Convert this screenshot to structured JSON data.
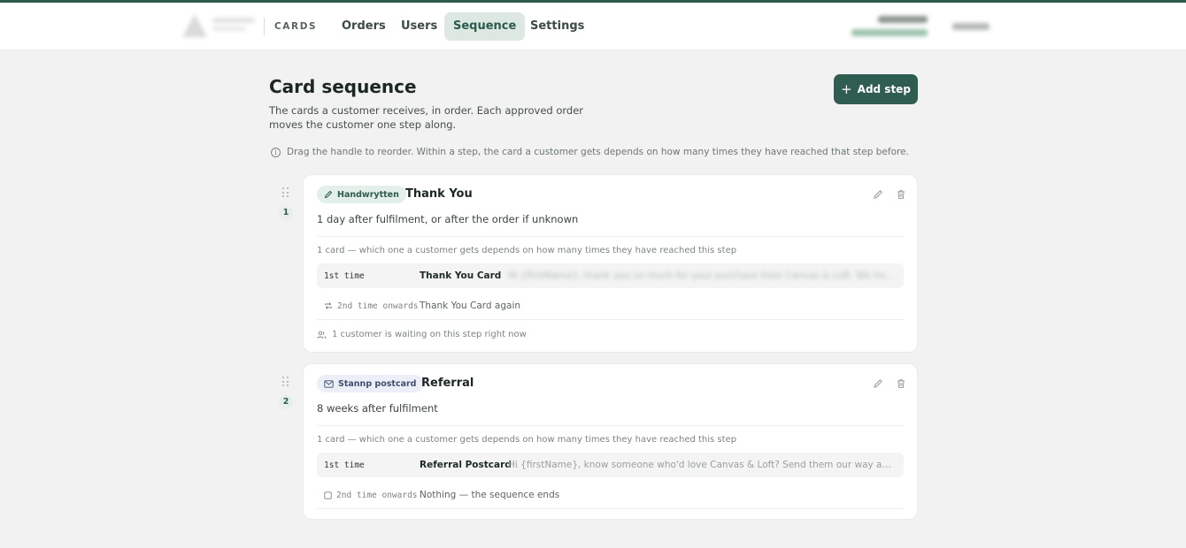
{
  "nav": {
    "brand": "CARDS",
    "items": [
      "Orders",
      "Users",
      "Sequence",
      "Settings"
    ],
    "active": "Sequence"
  },
  "page": {
    "title": "Card sequence",
    "description": "The cards a customer receives, in order. Each approved order moves the customer one step along.",
    "add_step": "Add step",
    "hint": "Drag the handle to reorder. Within a step, the card a customer gets depends on how many times they have reached that step before."
  },
  "steps": [
    {
      "number": "1",
      "type": "Handwrytten",
      "type_icon": "pen-icon",
      "name": "Thank You",
      "timing": "1 day after fulfilment, or after the order if unknown",
      "cards_info": "1 card — which one a customer gets depends on how many times they have reached this step",
      "variants": [
        {
          "when": "1st time",
          "card": "Thank You Card",
          "message": ""
        },
        {
          "when": "2nd time onwards",
          "when_icon": "repeat-icon",
          "card": "Thank You Card again"
        }
      ],
      "waiting": "1 customer is waiting on this step right now"
    },
    {
      "number": "2",
      "type": "Stannp postcard",
      "type_icon": "envelope-icon",
      "name": "Referral",
      "timing": "8 weeks after fulfilment",
      "cards_info": "1 card — which one a customer gets depends on how many times they have reached this step",
      "variants": [
        {
          "when": "1st time",
          "card": "Referral Postcard",
          "message": "Hi {firstName}, know someone who'd love Canvas & Loft? Send them our way and y..."
        },
        {
          "when": "2nd time onwards",
          "when_icon": "stop-icon",
          "card": "Nothing — the sequence ends"
        }
      ]
    }
  ],
  "colors": {
    "accent": "#2f5d50",
    "active_nav_bg": "#dde8e3",
    "page_bg": "#f1f2f1"
  }
}
